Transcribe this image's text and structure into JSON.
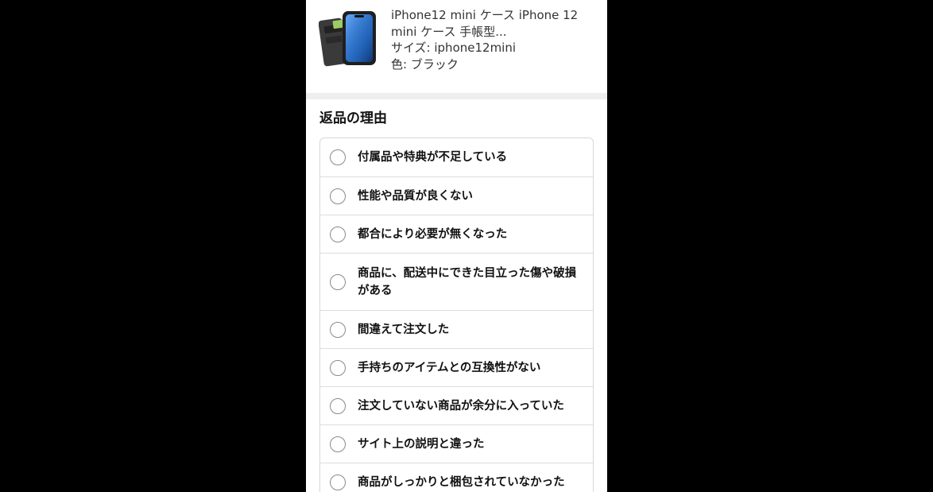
{
  "product": {
    "title": "iPhone12 mini ケース iPhone 12 mini ケース 手帳型...",
    "size": "サイズ: iphone12mini",
    "color": "色: ブラック",
    "thumbnail_icon": "phone-case-thumbnail"
  },
  "return_reason": {
    "heading": "返品の理由",
    "options": [
      {
        "label": "付属品や特典が不足している"
      },
      {
        "label": "性能や品質が良くない"
      },
      {
        "label": "都合により必要が無くなった"
      },
      {
        "label": "商品に、配送中にできた目立った傷や破損がある"
      },
      {
        "label": "間違えて注文した"
      },
      {
        "label": "手持ちのアイテムとの互換性がない"
      },
      {
        "label": "注文していない商品が余分に入っていた"
      },
      {
        "label": "サイト上の説明と違った"
      },
      {
        "label": "商品がしっかりと梱包されていなかった"
      }
    ]
  },
  "colors": {
    "background_outside": "#000000",
    "panel": "#ffffff",
    "separator": "#eeeeee",
    "border": "#d5d9d9",
    "text": "#111111"
  }
}
